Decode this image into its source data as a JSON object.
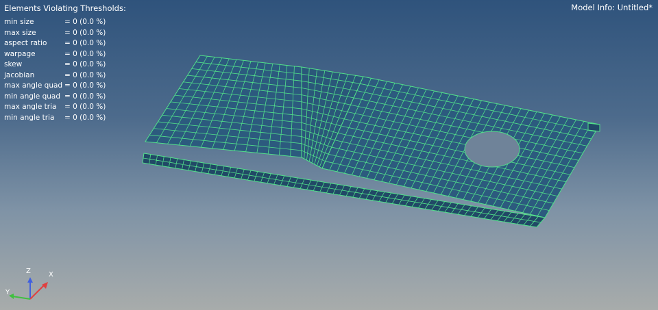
{
  "overlay": {
    "title": "Elements Violating Thresholds:",
    "model_info": "Model Info: Untitled*"
  },
  "metrics": [
    {
      "name": "min size",
      "value": "= 0 (0.0 %)"
    },
    {
      "name": "max size",
      "value": "= 0 (0.0 %)"
    },
    {
      "name": "aspect ratio",
      "value": "= 0 (0.0 %)"
    },
    {
      "name": "warpage",
      "value": "= 0 (0.0 %)"
    },
    {
      "name": "skew",
      "value": "= 0 (0.0 %)"
    },
    {
      "name": "jacobian",
      "value": "= 0 (0.0 %)"
    },
    {
      "name": "max angle quad",
      "value": "= 0 (0.0 %)"
    },
    {
      "name": "min angle quad",
      "value": "= 0 (0.0 %)"
    },
    {
      "name": "max angle tria",
      "value": "= 0 (0.0 %)"
    },
    {
      "name": "min angle tria",
      "value": "= 0 (0.0 %)"
    }
  ],
  "triad": {
    "x": "X",
    "y": "Y",
    "z": "Z"
  },
  "colors": {
    "mesh_fill": "#2c5a7e",
    "mesh_fill_dark": "#214866",
    "mesh_lines": "#52e08a",
    "axis_x": "#e04040",
    "axis_y": "#40c040",
    "axis_z": "#4060e0"
  }
}
